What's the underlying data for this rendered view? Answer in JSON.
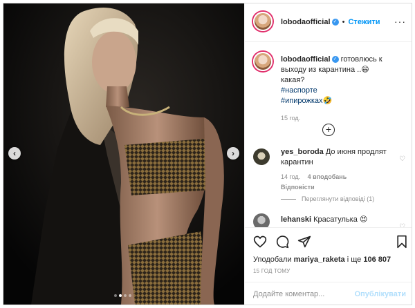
{
  "post": {
    "username": "lobodaofficial",
    "follow_label": "Стежити",
    "more_label": "···",
    "verified_mark": "✓"
  },
  "photo": {
    "prev_arrow": "‹",
    "next_arrow": "›",
    "dots_count": 4,
    "active_dot": 1
  },
  "caption": {
    "username": "lobodaofficial",
    "text": "готовлюсь к выходу из карантина ..😄",
    "line2": "какая?",
    "hashtags": [
      "#наспорте",
      "#ипирожках🤣"
    ],
    "time": "15 год."
  },
  "load_more": "+",
  "comments": [
    {
      "username": "yes_boroda",
      "text": "До июня продлят карантин",
      "time": "14 год.",
      "likes": "4 вподобань",
      "reply": "Відповісти",
      "view_replies": "Переглянути відповіді (1)"
    },
    {
      "username": "lehanski",
      "text": "Красатулька 😍"
    }
  ],
  "likes_line": {
    "prefix": "Уподобали",
    "user": "mariya_raketa",
    "middle": "і ще",
    "count": "106 807"
  },
  "post_time": "15 ГОД ТОМУ",
  "comment_box": {
    "placeholder": "Додайте коментар...",
    "publish_label": "Опублікувати"
  },
  "icons": {
    "like": "heart-icon",
    "comment": "comment-icon",
    "share": "share-icon",
    "save": "bookmark-icon"
  }
}
